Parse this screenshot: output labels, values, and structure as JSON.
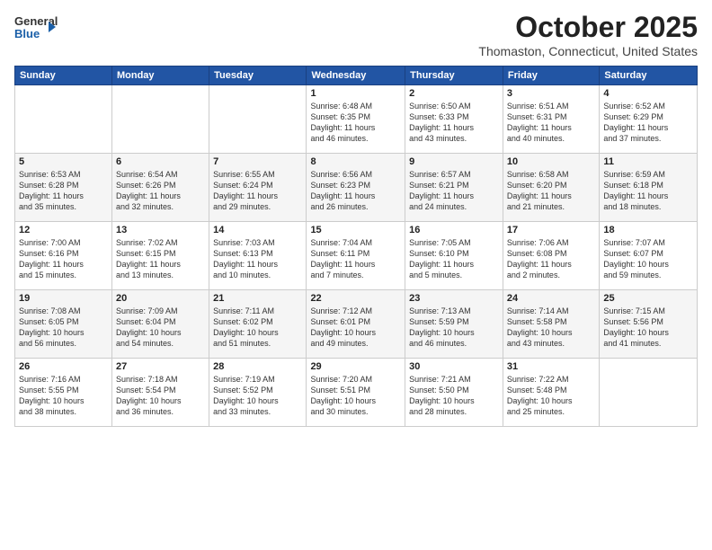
{
  "header": {
    "logo_general": "General",
    "logo_blue": "Blue",
    "month": "October 2025",
    "location": "Thomaston, Connecticut, United States"
  },
  "days_of_week": [
    "Sunday",
    "Monday",
    "Tuesday",
    "Wednesday",
    "Thursday",
    "Friday",
    "Saturday"
  ],
  "weeks": [
    [
      {
        "day": "",
        "content": ""
      },
      {
        "day": "",
        "content": ""
      },
      {
        "day": "",
        "content": ""
      },
      {
        "day": "1",
        "content": "Sunrise: 6:48 AM\nSunset: 6:35 PM\nDaylight: 11 hours\nand 46 minutes."
      },
      {
        "day": "2",
        "content": "Sunrise: 6:50 AM\nSunset: 6:33 PM\nDaylight: 11 hours\nand 43 minutes."
      },
      {
        "day": "3",
        "content": "Sunrise: 6:51 AM\nSunset: 6:31 PM\nDaylight: 11 hours\nand 40 minutes."
      },
      {
        "day": "4",
        "content": "Sunrise: 6:52 AM\nSunset: 6:29 PM\nDaylight: 11 hours\nand 37 minutes."
      }
    ],
    [
      {
        "day": "5",
        "content": "Sunrise: 6:53 AM\nSunset: 6:28 PM\nDaylight: 11 hours\nand 35 minutes."
      },
      {
        "day": "6",
        "content": "Sunrise: 6:54 AM\nSunset: 6:26 PM\nDaylight: 11 hours\nand 32 minutes."
      },
      {
        "day": "7",
        "content": "Sunrise: 6:55 AM\nSunset: 6:24 PM\nDaylight: 11 hours\nand 29 minutes."
      },
      {
        "day": "8",
        "content": "Sunrise: 6:56 AM\nSunset: 6:23 PM\nDaylight: 11 hours\nand 26 minutes."
      },
      {
        "day": "9",
        "content": "Sunrise: 6:57 AM\nSunset: 6:21 PM\nDaylight: 11 hours\nand 24 minutes."
      },
      {
        "day": "10",
        "content": "Sunrise: 6:58 AM\nSunset: 6:20 PM\nDaylight: 11 hours\nand 21 minutes."
      },
      {
        "day": "11",
        "content": "Sunrise: 6:59 AM\nSunset: 6:18 PM\nDaylight: 11 hours\nand 18 minutes."
      }
    ],
    [
      {
        "day": "12",
        "content": "Sunrise: 7:00 AM\nSunset: 6:16 PM\nDaylight: 11 hours\nand 15 minutes."
      },
      {
        "day": "13",
        "content": "Sunrise: 7:02 AM\nSunset: 6:15 PM\nDaylight: 11 hours\nand 13 minutes."
      },
      {
        "day": "14",
        "content": "Sunrise: 7:03 AM\nSunset: 6:13 PM\nDaylight: 11 hours\nand 10 minutes."
      },
      {
        "day": "15",
        "content": "Sunrise: 7:04 AM\nSunset: 6:11 PM\nDaylight: 11 hours\nand 7 minutes."
      },
      {
        "day": "16",
        "content": "Sunrise: 7:05 AM\nSunset: 6:10 PM\nDaylight: 11 hours\nand 5 minutes."
      },
      {
        "day": "17",
        "content": "Sunrise: 7:06 AM\nSunset: 6:08 PM\nDaylight: 11 hours\nand 2 minutes."
      },
      {
        "day": "18",
        "content": "Sunrise: 7:07 AM\nSunset: 6:07 PM\nDaylight: 10 hours\nand 59 minutes."
      }
    ],
    [
      {
        "day": "19",
        "content": "Sunrise: 7:08 AM\nSunset: 6:05 PM\nDaylight: 10 hours\nand 56 minutes."
      },
      {
        "day": "20",
        "content": "Sunrise: 7:09 AM\nSunset: 6:04 PM\nDaylight: 10 hours\nand 54 minutes."
      },
      {
        "day": "21",
        "content": "Sunrise: 7:11 AM\nSunset: 6:02 PM\nDaylight: 10 hours\nand 51 minutes."
      },
      {
        "day": "22",
        "content": "Sunrise: 7:12 AM\nSunset: 6:01 PM\nDaylight: 10 hours\nand 49 minutes."
      },
      {
        "day": "23",
        "content": "Sunrise: 7:13 AM\nSunset: 5:59 PM\nDaylight: 10 hours\nand 46 minutes."
      },
      {
        "day": "24",
        "content": "Sunrise: 7:14 AM\nSunset: 5:58 PM\nDaylight: 10 hours\nand 43 minutes."
      },
      {
        "day": "25",
        "content": "Sunrise: 7:15 AM\nSunset: 5:56 PM\nDaylight: 10 hours\nand 41 minutes."
      }
    ],
    [
      {
        "day": "26",
        "content": "Sunrise: 7:16 AM\nSunset: 5:55 PM\nDaylight: 10 hours\nand 38 minutes."
      },
      {
        "day": "27",
        "content": "Sunrise: 7:18 AM\nSunset: 5:54 PM\nDaylight: 10 hours\nand 36 minutes."
      },
      {
        "day": "28",
        "content": "Sunrise: 7:19 AM\nSunset: 5:52 PM\nDaylight: 10 hours\nand 33 minutes."
      },
      {
        "day": "29",
        "content": "Sunrise: 7:20 AM\nSunset: 5:51 PM\nDaylight: 10 hours\nand 30 minutes."
      },
      {
        "day": "30",
        "content": "Sunrise: 7:21 AM\nSunset: 5:50 PM\nDaylight: 10 hours\nand 28 minutes."
      },
      {
        "day": "31",
        "content": "Sunrise: 7:22 AM\nSunset: 5:48 PM\nDaylight: 10 hours\nand 25 minutes."
      },
      {
        "day": "",
        "content": ""
      }
    ]
  ]
}
